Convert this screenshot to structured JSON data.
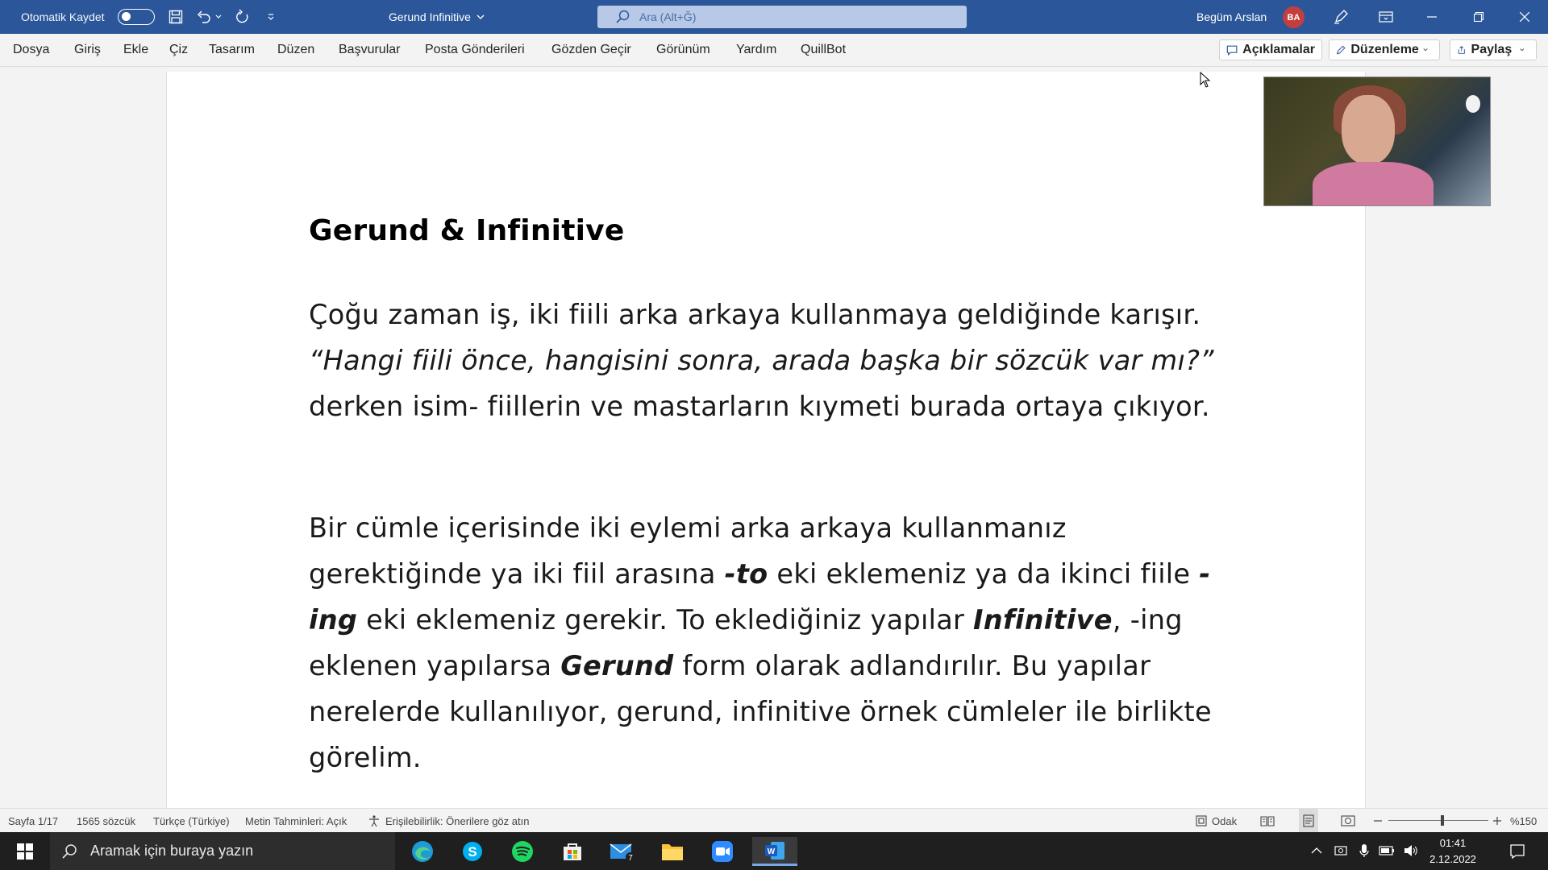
{
  "titlebar": {
    "autosave_label": "Otomatik Kaydet",
    "doc_title": "Gerund Infinitive",
    "search_placeholder": "Ara (Alt+Ğ)",
    "user_name": "Begüm Arslan",
    "user_initials": "BA"
  },
  "menu": {
    "items": [
      "Dosya",
      "Giriş",
      "Ekle",
      "Çiz",
      "Tasarım",
      "Düzen",
      "Başvurular",
      "Posta Gönderileri",
      "Gözden Geçir",
      "Görünüm",
      "Yardım",
      "QuillBot"
    ],
    "comments": "Açıklamalar",
    "editing": "Düzenleme",
    "share": "Paylaş"
  },
  "document": {
    "title": "Gerund & Infinitive",
    "p1_a": "Çoğu zaman iş, iki fiili arka arkaya kullanmaya geldiğinde karışır.",
    "p1_b_italic": "“Hangi fiili önce, hangisini sonra, arada başka bir sözcük var mı?”",
    "p1_c": " derken isim- fiillerin ve mastarların kıymeti burada ortaya çıkıyor.",
    "p2_a": "Bir cümle içerisinde iki eylemi arka arkaya kullanmanız gerektiğinde ya iki fiil arasına ",
    "p2_to": "-to",
    "p2_b": " eki eklemeniz ya da ikinci fiile ",
    "p2_ing": "-ing",
    "p2_c": " eki eklemeniz gerekir. To eklediğiniz yapılar ",
    "p2_inf": "Infinitive",
    "p2_d": ", -ing eklenen yapılarsa ",
    "p2_ger": "Gerund",
    "p2_e": " form olarak adlandırılır. Bu yapılar nerelerde kullanılıyor, gerund, infinitive örnek cümleler ile birlikte görelim."
  },
  "status": {
    "page": "Sayfa 1/17",
    "words": "1565 sözcük",
    "language": "Türkçe (Türkiye)",
    "predictions": "Metin Tahminleri: Açık",
    "accessibility": "Erişilebilirlik: Önerilere göz atın",
    "focus": "Odak",
    "zoom": "%150"
  },
  "taskbar": {
    "search_placeholder": "Aramak için buraya yazın",
    "time": "01:41",
    "date": "2.12.2022",
    "mail_badge": "7"
  },
  "colors": {
    "word_blue": "#2b579a",
    "avatar_red": "#c43e3e"
  }
}
